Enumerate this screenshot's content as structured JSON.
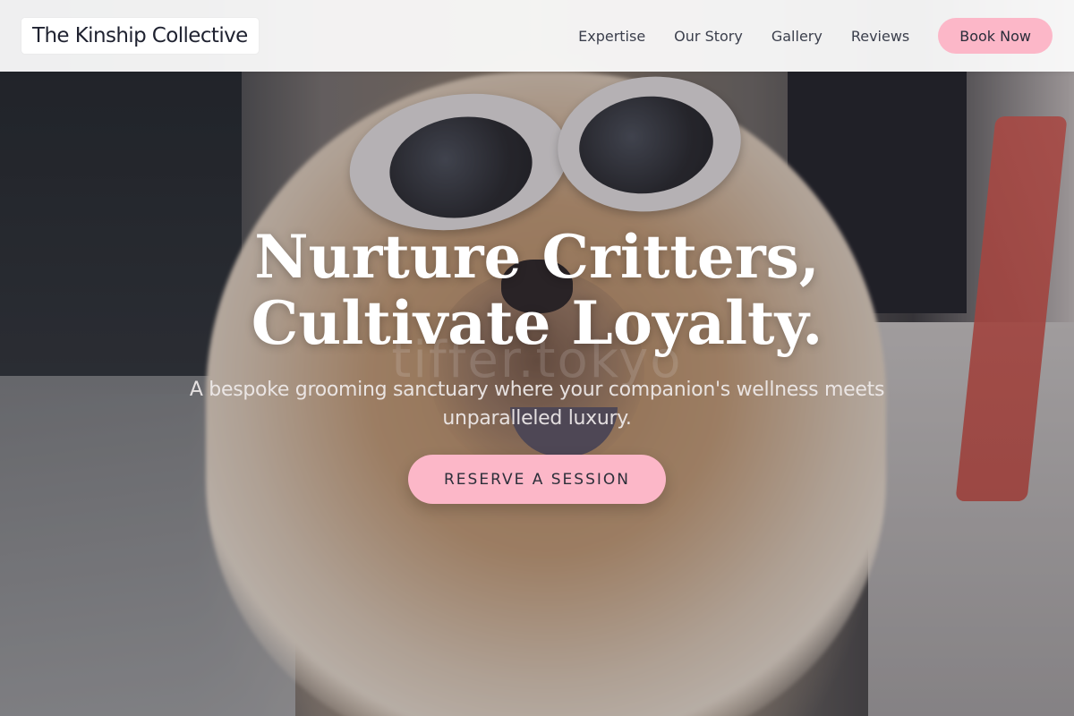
{
  "brand": {
    "name": "The Kinship Collective"
  },
  "nav": {
    "links": [
      "Expertise",
      "Our Story",
      "Gallery",
      "Reviews"
    ],
    "book_label": "Book Now"
  },
  "hero": {
    "headline_line1": "Nurture Critters,",
    "headline_line2": "Cultivate Loyalty.",
    "subhead": "A bespoke grooming sanctuary where your companion's wellness meets unparalleled luxury.",
    "cta_label": "RESERVE A SESSION",
    "watermark": "tiffer.tokyo"
  },
  "colors": {
    "accent_pink": "#fcb7c8",
    "text_dark": "#1f2230",
    "nav_bg": "#fcfcfc"
  }
}
